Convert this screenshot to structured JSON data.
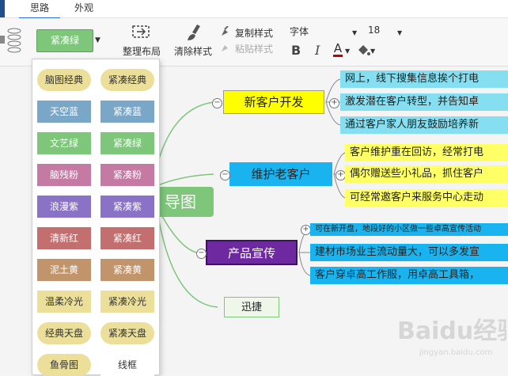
{
  "tabs": [
    {
      "label": "思路"
    },
    {
      "label": "外观"
    }
  ],
  "toolbar": {
    "style_label": "紧凑绿",
    "layout_label": "整理布局",
    "clear_label": "清除样式",
    "copy_style_label": "复制样式",
    "paste_style_label": "粘贴样式",
    "font_label": "字体",
    "font_size": "18",
    "bold_label": "B",
    "italic_label": "I",
    "font_color_label": "A"
  },
  "dropdown": {
    "items": [
      {
        "label": "脑图经典",
        "bg": "#ebdf9a",
        "fg": "#333333",
        "shape": "pill"
      },
      {
        "label": "紧凑经典",
        "bg": "#ebdf9a",
        "fg": "#333333",
        "shape": "pill"
      },
      {
        "label": "天空蓝",
        "bg": "#7aa6c8",
        "fg": "#ffffff",
        "shape": "rect"
      },
      {
        "label": "紧凑蓝",
        "bg": "#7aa6c8",
        "fg": "#ffffff",
        "shape": "rect"
      },
      {
        "label": "文艺绿",
        "bg": "#7dc67a",
        "fg": "#ffffff",
        "shape": "rect"
      },
      {
        "label": "紧凑绿",
        "bg": "#7dc67a",
        "fg": "#ffffff",
        "shape": "rect"
      },
      {
        "label": "脑残粉",
        "bg": "#c47aa3",
        "fg": "#ffffff",
        "shape": "rect"
      },
      {
        "label": "紧凑粉",
        "bg": "#c47aa3",
        "fg": "#ffffff",
        "shape": "rect"
      },
      {
        "label": "浪漫紫",
        "bg": "#8a73c6",
        "fg": "#ffffff",
        "shape": "rect"
      },
      {
        "label": "紧凑紫",
        "bg": "#8a73c6",
        "fg": "#ffffff",
        "shape": "rect"
      },
      {
        "label": "清新红",
        "bg": "#c46f6f",
        "fg": "#ffffff",
        "shape": "rect"
      },
      {
        "label": "紧凑红",
        "bg": "#c46f6f",
        "fg": "#ffffff",
        "shape": "rect"
      },
      {
        "label": "泥土黄",
        "bg": "#c2946c",
        "fg": "#ffffff",
        "shape": "rect"
      },
      {
        "label": "紧凑黄",
        "bg": "#c2946c",
        "fg": "#ffffff",
        "shape": "rect"
      },
      {
        "label": "温柔冷光",
        "bg": "#ebdf9a",
        "fg": "#333333",
        "shape": "rect"
      },
      {
        "label": "紧凑冷光",
        "bg": "#ebdf9a",
        "fg": "#333333",
        "shape": "rect"
      },
      {
        "label": "经典天盘",
        "bg": "#ebdf9a",
        "fg": "#333333",
        "shape": "pill"
      },
      {
        "label": "紧凑天盘",
        "bg": "#ebdf9a",
        "fg": "#333333",
        "shape": "pill"
      },
      {
        "label": "鱼骨图",
        "bg": "#ebdf9a",
        "fg": "#333333",
        "shape": "pill"
      },
      {
        "label": "线框",
        "bg": "#ffffff",
        "fg": "#333333",
        "shape": "rect"
      }
    ]
  },
  "mindmap": {
    "root_label": "导图",
    "topics": [
      {
        "label": "新客户开发",
        "bg": "#ffff00",
        "fg": "#222222",
        "branches": [
          {
            "text": "网上，线下搜集信息挨个打电",
            "bg": "#86dff0"
          },
          {
            "text": "激发潜在客户转型，并告知卓",
            "bg": "#86dff0"
          },
          {
            "text": "通过客户家人朋友鼓励培养新",
            "bg": "#86dff0"
          }
        ]
      },
      {
        "label": "维护老客户",
        "bg": "#19b4ef",
        "fg": "#222222",
        "branches": [
          {
            "text": "客户维护重在回访，经常打电",
            "bg": "#ffff66"
          },
          {
            "text": "偶尔赠送些小礼品，抓住客户",
            "bg": "#ffff66"
          },
          {
            "text": "可经常邀客户来服务中心走动",
            "bg": "#ffff66"
          }
        ]
      },
      {
        "label": "产品宣传",
        "bg": "#6e28a0",
        "fg": "#ffffff",
        "branches": [
          {
            "text": "可在新开盘，地段好的小区做一些卓高宣传活动",
            "bg": "#19b4ef",
            "small": true
          },
          {
            "text": "建材市场业主流动量大，可以多发宣",
            "bg": "#19b4ef"
          },
          {
            "text": "客户穿卓高工作服，用卓高工具箱，",
            "bg": "#19b4ef"
          }
        ]
      },
      {
        "label": "迅捷",
        "bg": "#eef7ea",
        "fg": "#222222",
        "branches": []
      }
    ]
  },
  "colors": {
    "accent": "#2b6cd0",
    "root_green": "#7dc67a"
  }
}
